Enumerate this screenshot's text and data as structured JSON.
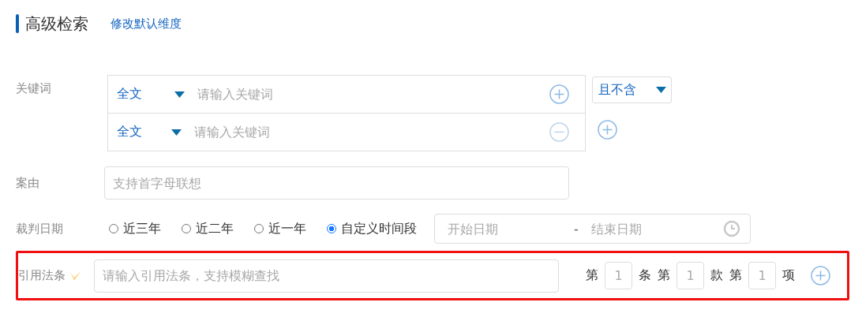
{
  "header": {
    "title": "高级检索",
    "link": "修改默认维度"
  },
  "keyword": {
    "label": "关键词",
    "rows": [
      {
        "field": "全文",
        "placeholder": "请输入关键词",
        "kind": "add"
      },
      {
        "field": "全文",
        "placeholder": "请输入关键词",
        "kind": "remove"
      }
    ],
    "logic": "且不含"
  },
  "cause": {
    "label": "案由",
    "placeholder": "支持首字母联想"
  },
  "date": {
    "label": "裁判日期",
    "options": [
      {
        "label": "近三年",
        "selected": false
      },
      {
        "label": "近二年",
        "selected": false
      },
      {
        "label": "近一年",
        "selected": false
      },
      {
        "label": "自定义时间段",
        "selected": true
      }
    ],
    "start_placeholder": "开始日期",
    "separator": "-",
    "end_placeholder": "结束日期"
  },
  "law": {
    "label": "引用法条",
    "highlighted": true,
    "placeholder": "请输入引用法条，支持模糊查找",
    "parts": [
      {
        "prefix": "第",
        "value": "1",
        "suffix": "条"
      },
      {
        "prefix": "第",
        "value": "1",
        "suffix": "款"
      },
      {
        "prefix": "第",
        "value": "1",
        "suffix": "项"
      }
    ]
  }
}
